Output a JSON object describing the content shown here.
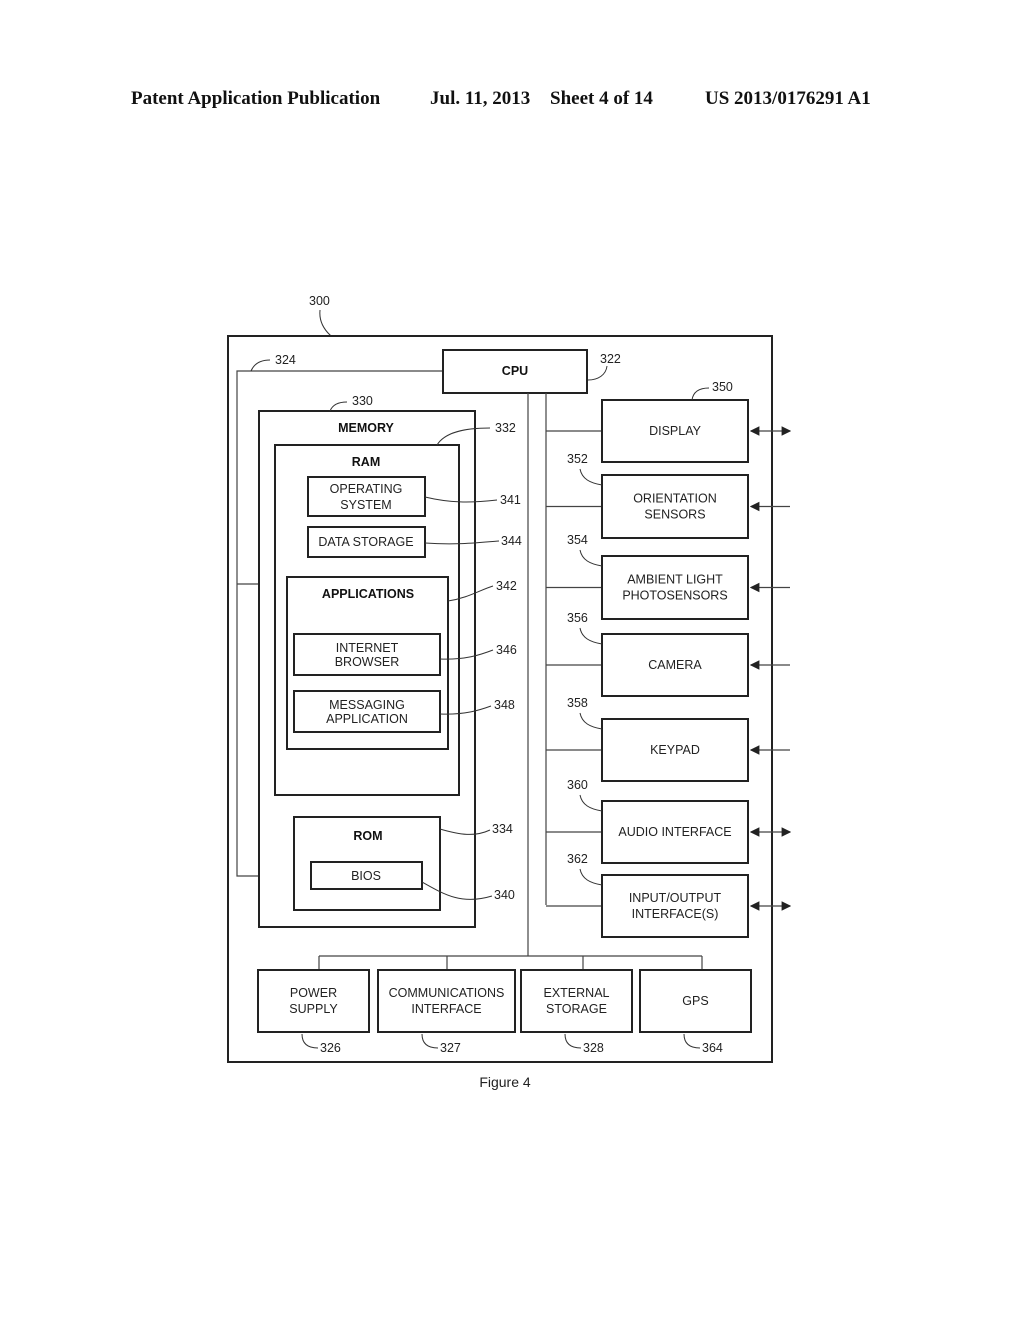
{
  "header": {
    "left": "Patent Application Publication",
    "date": "Jul. 11, 2013",
    "sheet": "Sheet 4 of 14",
    "number": "US 2013/0176291 A1"
  },
  "figure": {
    "caption": "Figure 4",
    "device_ref": "300",
    "bus_ref": "324",
    "cpu": {
      "label": "CPU",
      "ref": "322"
    },
    "memory": {
      "label": "MEMORY",
      "ref": "330",
      "ram": {
        "label": "RAM",
        "ref": "332",
        "os": {
          "lines": [
            "OPERATING",
            "SYSTEM"
          ],
          "ref": "341"
        },
        "data_storage": {
          "label": "DATA STORAGE",
          "ref": "344"
        },
        "applications": {
          "label": "APPLICATIONS",
          "ref": "342",
          "browser": {
            "lines": [
              "INTERNET",
              "BROWSER"
            ],
            "ref": "346"
          },
          "messaging": {
            "lines": [
              "MESSAGING",
              "APPLICATION"
            ],
            "ref": "348"
          }
        }
      },
      "rom": {
        "label": "ROM",
        "ref": "334",
        "bios": {
          "label": "BIOS",
          "ref": "340"
        }
      }
    },
    "peripherals": [
      {
        "lines": [
          "DISPLAY"
        ],
        "ref": "350",
        "arrow": "both"
      },
      {
        "lines": [
          "ORIENTATION",
          "SENSORS"
        ],
        "ref": "352",
        "arrow": "in"
      },
      {
        "lines": [
          "AMBIENT LIGHT",
          "PHOTOSENSORS"
        ],
        "ref": "354",
        "arrow": "in"
      },
      {
        "lines": [
          "CAMERA"
        ],
        "ref": "356",
        "arrow": "in"
      },
      {
        "lines": [
          "KEYPAD"
        ],
        "ref": "358",
        "arrow": "in"
      },
      {
        "lines": [
          "AUDIO INTERFACE"
        ],
        "ref": "360",
        "arrow": "both"
      },
      {
        "lines": [
          "INPUT/OUTPUT",
          "INTERFACE(S)"
        ],
        "ref": "362",
        "arrow": "both"
      }
    ],
    "bottom": [
      {
        "lines": [
          "POWER",
          "SUPPLY"
        ],
        "ref": "326"
      },
      {
        "lines": [
          "COMMUNICATIONS",
          "INTERFACE"
        ],
        "ref": "327"
      },
      {
        "lines": [
          "EXTERNAL",
          "STORAGE"
        ],
        "ref": "328"
      },
      {
        "lines": [
          "GPS"
        ],
        "ref": "364"
      }
    ]
  }
}
